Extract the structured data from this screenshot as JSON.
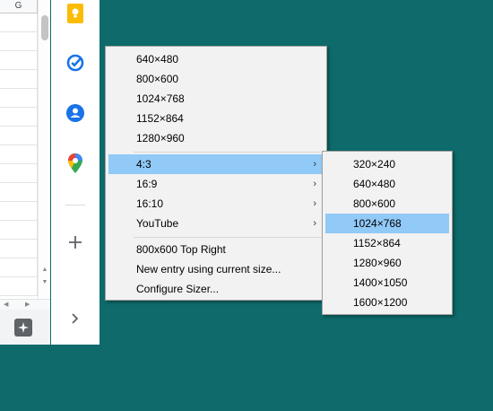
{
  "sheet": {
    "column_header": "G",
    "row_count": 15,
    "explore_icon": "sparkle-icon"
  },
  "side_panel": {
    "icons": [
      {
        "name": "keep-icon",
        "color": "#fbbc04"
      },
      {
        "name": "tasks-icon",
        "color": "#1a73e8"
      },
      {
        "name": "contacts-icon",
        "color": "#1a73e8"
      },
      {
        "name": "maps-icon",
        "color": "#34a853"
      },
      {
        "name": "add-icon",
        "color": "#5f6368"
      },
      {
        "name": "chevron-right-icon",
        "color": "#5f6368"
      }
    ]
  },
  "context_menu": {
    "items": [
      {
        "label": "640×480"
      },
      {
        "label": "800×600"
      },
      {
        "label": "1024×768"
      },
      {
        "label": "1152×864"
      },
      {
        "label": "1280×960"
      },
      {
        "label": "4:3",
        "submenu": true,
        "highlighted": true
      },
      {
        "label": "16:9",
        "submenu": true
      },
      {
        "label": "16:10",
        "submenu": true
      },
      {
        "label": "YouTube",
        "submenu": true
      },
      {
        "label": "800x600 Top Right"
      },
      {
        "label": "New entry using current size..."
      },
      {
        "label": "Configure Sizer..."
      }
    ],
    "submenu_arrow": "›"
  },
  "submenu": {
    "items": [
      {
        "label": "320×240"
      },
      {
        "label": "640×480"
      },
      {
        "label": "800×600"
      },
      {
        "label": "1024×768",
        "highlighted": true
      },
      {
        "label": "1152×864"
      },
      {
        "label": "1280×960"
      },
      {
        "label": "1400×1050"
      },
      {
        "label": "1600×1200"
      }
    ]
  },
  "colors": {
    "desktop": "#0e6a6b",
    "menu_bg": "#f2f2f2",
    "highlight": "#91c9f7"
  }
}
